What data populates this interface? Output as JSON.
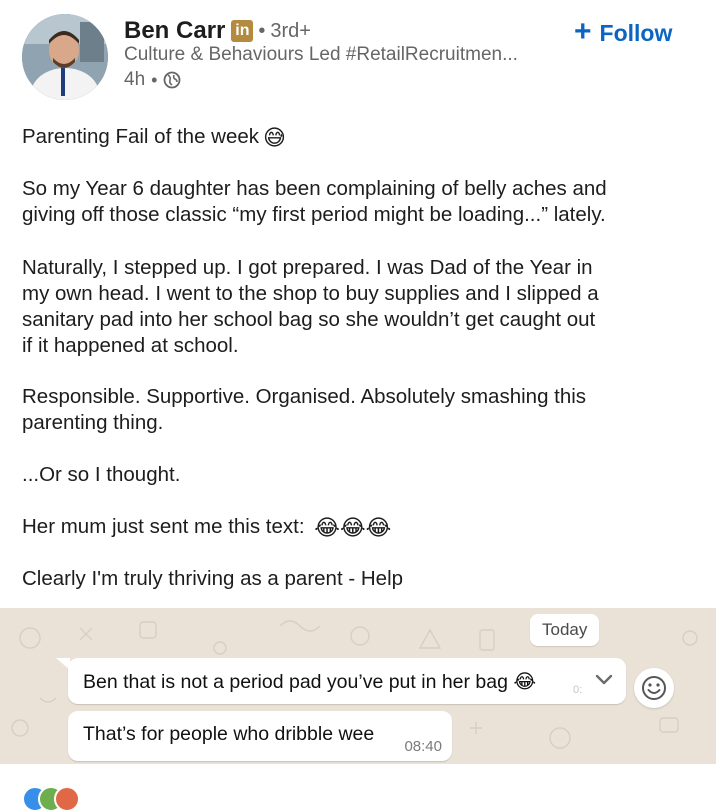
{
  "author": {
    "name": "Ben Carr",
    "badge": "in",
    "degree": "3rd+",
    "headline": "Culture & Behaviours Led #RetailRecruitmen...",
    "time": "4h",
    "separator": "•",
    "visibility_icon": "globe-icon"
  },
  "follow": {
    "plus": "+",
    "label": "Follow"
  },
  "post": {
    "l1": "Parenting Fail of the week",
    "e1": "😅",
    "l2": "So my Year 6 daughter has been complaining of belly aches and",
    "l3": "giving off those classic “my first period might be loading...” lately.",
    "l4": "Naturally, I stepped up. I got prepared. I was Dad of the Year in",
    "l5": "my own head. I went to the shop to buy supplies and I slipped a",
    "l6": "sanitary pad into her school bag so she wouldn’t get caught out",
    "l7": "if it happened at school.",
    "l8": "Responsible. Supportive. Organised. Absolutely smashing this",
    "l9": "parenting thing.",
    "l10": "...Or so I thought.",
    "l11": "Her mum just sent me this text:",
    "e11": "😂😂😂",
    "l12": "Clearly I'm truly thriving as a parent - Help"
  },
  "chat": {
    "date_chip": "Today",
    "msg1": "Ben that is not a period pad you’ve put in her bag",
    "msg1_emoji": "😂",
    "msg2": "That’s for people who dribble wee",
    "msg2_time": "08:40"
  },
  "colors": {
    "link_blue": "#0a66c2",
    "badge_gold": "#b38a3e",
    "chat_bg": "#eae2d7",
    "muted_text": "#666666"
  }
}
